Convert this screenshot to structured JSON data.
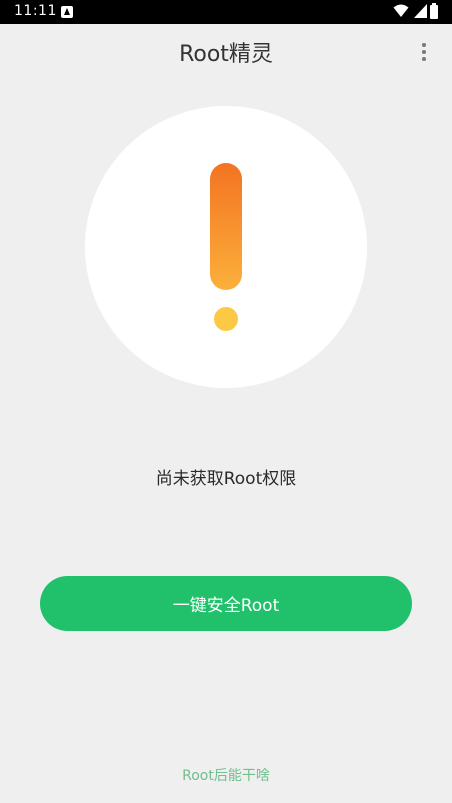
{
  "status_bar": {
    "time": "11:11",
    "icons": [
      "notification-icon",
      "wifi-icon",
      "signal-icon",
      "battery-icon"
    ]
  },
  "toolbar": {
    "title": "Root精灵",
    "menu_icon": "more-vert-icon"
  },
  "main": {
    "status_icon": "exclamation-warning-icon",
    "status_text": "尚未获取Root权限",
    "root_button_label": "一键安全Root",
    "help_link": "Root后能干啥"
  },
  "colors": {
    "background": "#efefef",
    "primary_button": "#20c16a",
    "link": "#6fbf8c",
    "warning_gradient_top": "#f47322",
    "warning_gradient_bottom": "#fbb03b",
    "warning_dot": "#fcc944"
  }
}
